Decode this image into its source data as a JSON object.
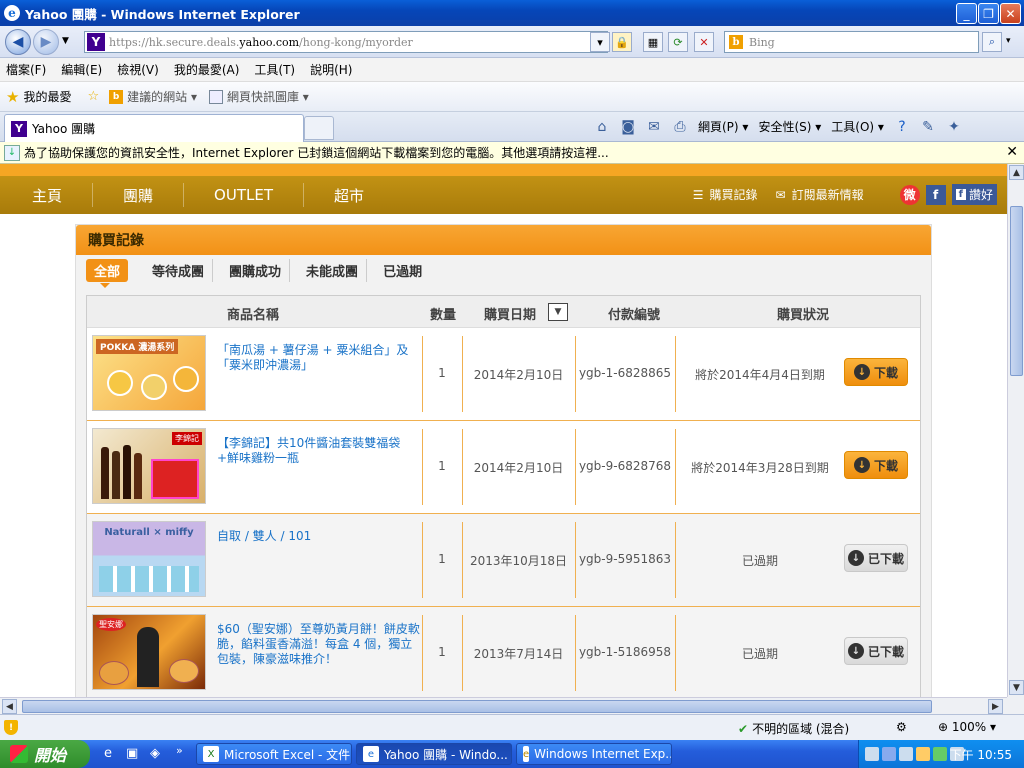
{
  "window": {
    "title": "Yahoo 團購 - Windows Internet Explorer",
    "url_prefix": "https://hk.secure.deals.",
    "url_domain": "yahoo.com",
    "url_path": "/hong-kong/myorder",
    "search_placeholder": "Bing"
  },
  "menu": [
    "檔案(F)",
    "編輯(E)",
    "檢視(V)",
    "我的最愛(A)",
    "工具(T)",
    "說明(H)"
  ],
  "favorites": {
    "label": "我的最愛",
    "suggested": "建議的網站 ▾",
    "slices": "網頁快訊圖庫 ▾"
  },
  "tab": {
    "title": "Yahoo 團購"
  },
  "commandbar": {
    "page": "網頁(P) ▾",
    "safety": "安全性(S) ▾",
    "tools": "工具(O) ▾"
  },
  "infobar": {
    "text": "為了協助保護您的資訊安全性，Internet Explorer 已封鎖這個網站下載檔案到您的電腦。其他選項請按這裡..."
  },
  "site_nav": {
    "items": [
      "主頁",
      "團購",
      "OUTLET",
      "超市"
    ],
    "orders_link": "購買記錄",
    "subscribe_link": "訂閱最新情報",
    "share_label": "讚好"
  },
  "panel": {
    "title": "購買記錄",
    "filters": [
      "全部",
      "等待成團",
      "團購成功",
      "未能成團",
      "已過期"
    ],
    "headers": {
      "name": "商品名稱",
      "qty": "數量",
      "date": "購買日期",
      "payment": "付款編號",
      "status": "購買狀況"
    },
    "rows": [
      {
        "name": "「南瓜湯 + 薯仔湯 + 粟米組合」及「粟米即沖濃湯」",
        "qty": "1",
        "date": "2014年2月10日",
        "payment": "ygb-1-6828865",
        "status": "將於2014年4月4日到期",
        "button": "下載",
        "thumb_text": "POKKA 濃湯系列",
        "expired": false
      },
      {
        "name": "【李錦記】共10件醬油套裝雙福袋+鮮味雞粉一瓶",
        "qty": "1",
        "date": "2014年2月10日",
        "payment": "ygb-9-6828768",
        "status": "將於2014年3月28日到期",
        "button": "下載",
        "thumb_text": "李錦記",
        "expired": false
      },
      {
        "name": "自取 / 雙人 / 101",
        "qty": "1",
        "date": "2013年10月18日",
        "payment": "ygb-9-5951863",
        "status": "已過期",
        "button": "已下載",
        "thumb_text": "Naturall × miffy",
        "expired": true
      },
      {
        "name": "$60（聖安娜）至尊奶黃月餅！餅皮軟脆，餡料蛋香滿溢！每盒 4 個，獨立包裝，陳豪滋味推介！",
        "qty": "1",
        "date": "2013年7月14日",
        "payment": "ygb-1-5186958",
        "status": "已過期",
        "button": "已下載",
        "thumb_text": "聖安娜",
        "expired": true
      }
    ]
  },
  "statusbar": {
    "zone": "不明的區域 (混合)",
    "zoom": "100%"
  },
  "taskbar": {
    "start": "開始",
    "items": [
      "Microsoft Excel - 文件",
      "Yahoo 團購 - Windo...",
      "Windows Internet Exp..."
    ],
    "clock": "下午 10:55"
  },
  "colors": {
    "accent": "#f29116",
    "nav_bg": "#b8860b",
    "link": "#1a73c8"
  }
}
